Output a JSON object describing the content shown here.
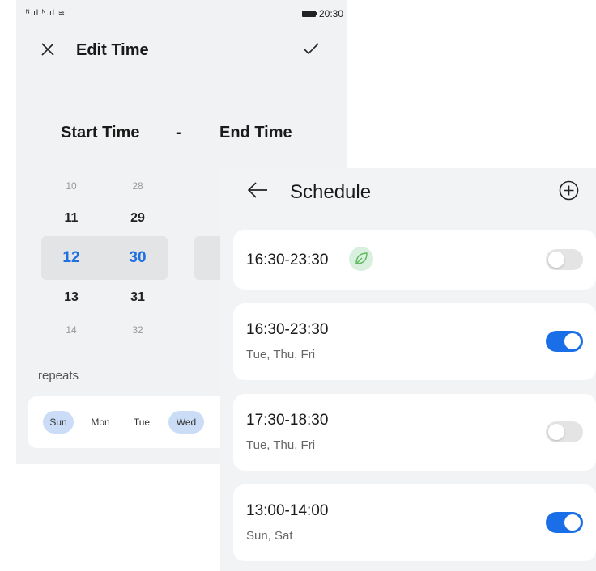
{
  "status_bar": {
    "signal": "ᴺ⸻⸻ ᴺ⸻⸻ ⸻",
    "time": "20:30"
  },
  "edit_time": {
    "title": "Edit Time",
    "start_label": "Start Time",
    "separator": "-",
    "end_label": "End Time",
    "hours": [
      "10",
      "11",
      "12",
      "13",
      "14"
    ],
    "minutes": [
      "28",
      "29",
      "30",
      "31",
      "32"
    ],
    "selected_hour": "12",
    "selected_minute": "30",
    "repeats_label": "repeats",
    "days": [
      {
        "label": "Sun",
        "selected": true
      },
      {
        "label": "Mon",
        "selected": false
      },
      {
        "label": "Tue",
        "selected": false
      },
      {
        "label": "Wed",
        "selected": true
      }
    ]
  },
  "schedule": {
    "title": "Schedule",
    "items": [
      {
        "time": "16:30-23:30",
        "days": "",
        "enabled": false,
        "badge_icon": "leaf-icon"
      },
      {
        "time": "16:30-23:30",
        "days": "Tue, Thu, Fri",
        "enabled": true
      },
      {
        "time": "17:30-18:30",
        "days": "Tue, Thu, Fri",
        "enabled": false
      },
      {
        "time": "13:00-14:00",
        "days": "Sun, Sat",
        "enabled": true
      }
    ]
  },
  "colors": {
    "accent": "#1a6fe8",
    "selected_picker_text": "#1f6fe0",
    "selected_day_chip": "#cbdcf7",
    "leaf_badge": "#d8f0dd",
    "leaf_icon": "#5cb85c"
  }
}
